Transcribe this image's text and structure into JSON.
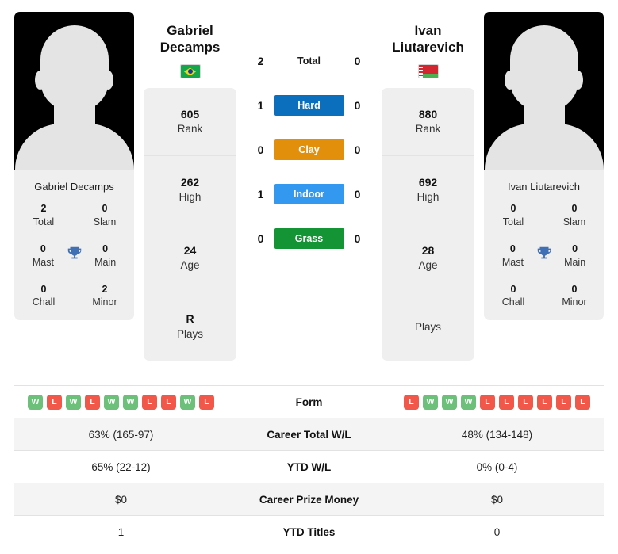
{
  "players": {
    "left": {
      "first_name": "Gabriel",
      "last_name": "Decamps",
      "full_name": "Gabriel Decamps",
      "country": "Brazil",
      "flag_icon": "flag-brazil-icon",
      "stats": [
        {
          "value": "605",
          "label": "Rank"
        },
        {
          "value": "262",
          "label": "High"
        },
        {
          "value": "24",
          "label": "Age"
        },
        {
          "value": "R",
          "label": "Plays"
        }
      ],
      "titles": [
        {
          "value": "2",
          "label": "Total"
        },
        {
          "value": "0",
          "label": "Slam"
        },
        {
          "value": "0",
          "label": "Mast"
        },
        {
          "value": "0",
          "label": "Main"
        },
        {
          "value": "0",
          "label": "Chall"
        },
        {
          "value": "2",
          "label": "Minor"
        }
      ],
      "form": [
        "W",
        "L",
        "W",
        "L",
        "W",
        "W",
        "L",
        "L",
        "W",
        "L"
      ]
    },
    "right": {
      "first_name": "Ivan",
      "last_name": "Liutarevich",
      "full_name": "Ivan Liutarevich",
      "country": "Belarus",
      "flag_icon": "flag-belarus-icon",
      "stats": [
        {
          "value": "880",
          "label": "Rank"
        },
        {
          "value": "692",
          "label": "High"
        },
        {
          "value": "28",
          "label": "Age"
        },
        {
          "value": "",
          "label": "Plays"
        }
      ],
      "titles": [
        {
          "value": "0",
          "label": "Total"
        },
        {
          "value": "0",
          "label": "Slam"
        },
        {
          "value": "0",
          "label": "Mast"
        },
        {
          "value": "0",
          "label": "Main"
        },
        {
          "value": "0",
          "label": "Chall"
        },
        {
          "value": "0",
          "label": "Minor"
        }
      ],
      "form": [
        "L",
        "W",
        "W",
        "W",
        "L",
        "L",
        "L",
        "L",
        "L",
        "L"
      ]
    }
  },
  "head_to_head": [
    {
      "label": "Total",
      "left": "2",
      "right": "0",
      "style": "plain",
      "color": ""
    },
    {
      "label": "Hard",
      "left": "1",
      "right": "0",
      "style": "hard",
      "color": "#0c6fbd"
    },
    {
      "label": "Clay",
      "left": "0",
      "right": "0",
      "style": "clay",
      "color": "#e2900c"
    },
    {
      "label": "Indoor",
      "left": "1",
      "right": "0",
      "style": "indoor",
      "color": "#3399f0"
    },
    {
      "label": "Grass",
      "left": "0",
      "right": "0",
      "style": "grass",
      "color": "#149434"
    }
  ],
  "comparison_table": {
    "form_label": "Form",
    "rows": [
      {
        "label": "Career Total W/L",
        "left": "63% (165-97)",
        "right": "48% (134-148)"
      },
      {
        "label": "YTD W/L",
        "left": "65% (22-12)",
        "right": "0% (0-4)"
      },
      {
        "label": "Career Prize Money",
        "left": "$0",
        "right": "$0"
      },
      {
        "label": "YTD Titles",
        "left": "1",
        "right": "0"
      }
    ]
  },
  "colors": {
    "badge_win": "#6cc07a",
    "badge_loss": "#f2584a",
    "card_bg": "#efefef",
    "trophy": "#3f6fb5"
  }
}
